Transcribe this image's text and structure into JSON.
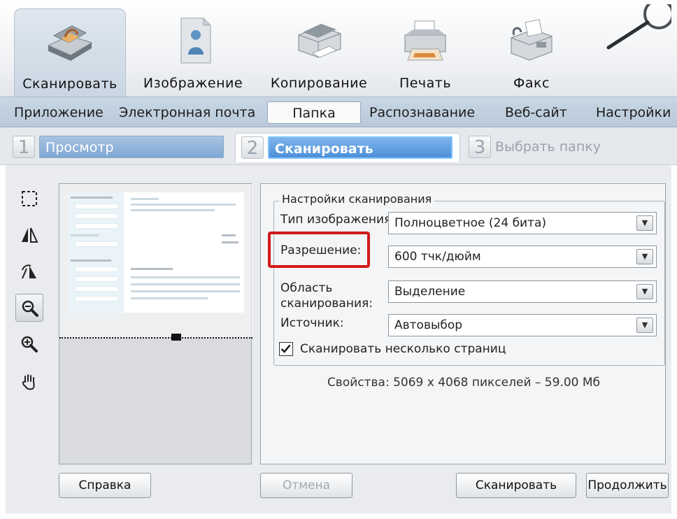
{
  "toolbar": {
    "items": [
      {
        "label": "Сканировать",
        "icon": "scanner-icon"
      },
      {
        "label": "Изображение",
        "icon": "image-document-icon"
      },
      {
        "label": "Копирование",
        "icon": "copier-icon"
      },
      {
        "label": "Печать",
        "icon": "printer-icon"
      },
      {
        "label": "Факс",
        "icon": "fax-icon"
      }
    ],
    "active_index": 0
  },
  "subtabs": {
    "items": [
      "Приложение",
      "Электронная почта",
      "Папка",
      "Распознавание",
      "Веб-сайт",
      "Настройки"
    ],
    "active_index": 2
  },
  "steps": {
    "items": [
      {
        "num": "1",
        "label": "Просмотр"
      },
      {
        "num": "2",
        "label": "Сканировать"
      },
      {
        "num": "3",
        "label": "Выбрать папку"
      }
    ],
    "current_index": 1
  },
  "settings": {
    "group_title": "Настройки сканирования",
    "image_type_label": "Тип изображения:",
    "image_type_value": "Полноцветное (24 бита)",
    "resolution_label": "Разрешение:",
    "resolution_value": "600 тчк/дюйм",
    "area_label_line1": "Область",
    "area_label_line2": "сканирования:",
    "area_value": "Выделение",
    "source_label": "Источник:",
    "source_value": "Автовыбор",
    "multi_page_label": "Сканировать несколько страниц",
    "multi_page_checked": true,
    "properties": "Свойства: 5069 x 4068 пикселей – 59.00 Мб"
  },
  "buttons": {
    "help": "Справка",
    "cancel": "Отмена",
    "scan": "Сканировать",
    "continue": "Продолжить"
  },
  "colors": {
    "highlight": "#d11a1a",
    "step_active": "#4d8fd8"
  }
}
